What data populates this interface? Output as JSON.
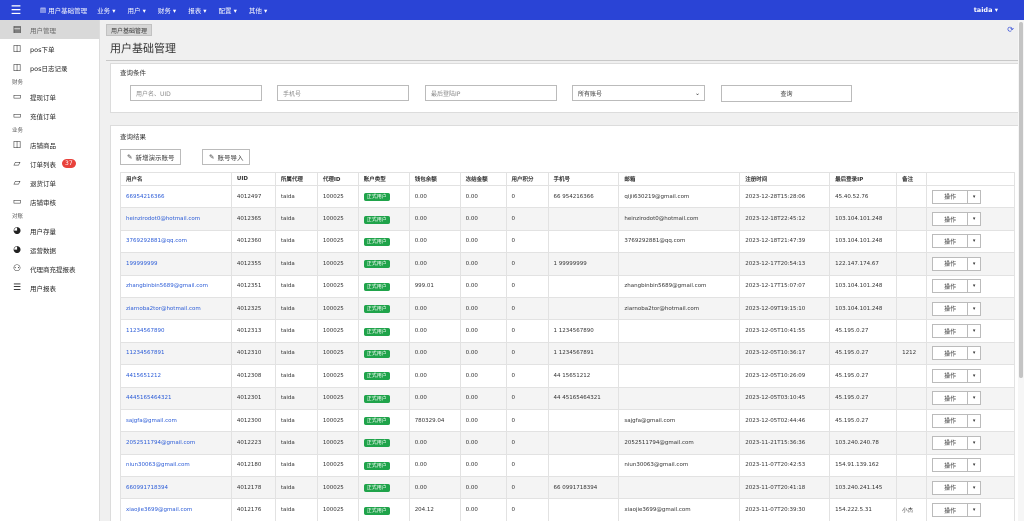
{
  "topbar": {
    "menu_icon": "hamburger-icon",
    "brand": "用户基础管理",
    "brand_icon": "document-icon",
    "menus": [
      "业务 ▾",
      "用户 ▾",
      "财务 ▾",
      "报表 ▾",
      "配置 ▾",
      "其他 ▾"
    ],
    "user": "taida ▾"
  },
  "sidebar": {
    "items": [
      {
        "label": "用户管理",
        "icon": "user-doc-icon",
        "glyph": "▤",
        "active": true
      },
      {
        "label": "pos下单",
        "icon": "columns-icon",
        "glyph": "◫"
      },
      {
        "label": "pos日志记录",
        "icon": "columns-icon",
        "glyph": "◫"
      },
      {
        "group": "财务"
      },
      {
        "label": "提现订单",
        "icon": "card-icon",
        "glyph": "▭"
      },
      {
        "label": "充值订单",
        "icon": "card-icon",
        "glyph": "▭"
      },
      {
        "group": "业务"
      },
      {
        "label": "店铺商品",
        "icon": "columns-icon",
        "glyph": "◫"
      },
      {
        "label": "订单列表",
        "icon": "order-icon",
        "glyph": "▱",
        "badge": "37"
      },
      {
        "label": "退货订单",
        "icon": "order-icon",
        "glyph": "▱"
      },
      {
        "label": "店铺审核",
        "icon": "card-icon",
        "glyph": "▭"
      },
      {
        "group": "对账"
      },
      {
        "label": "用户存量",
        "icon": "pie-chart-icon",
        "glyph": "◕"
      },
      {
        "label": "运营数据",
        "icon": "pie-chart-icon",
        "glyph": "◕"
      },
      {
        "label": "代理商充提报表",
        "icon": "sitemap-icon",
        "glyph": "⚇"
      },
      {
        "label": "用户报表",
        "icon": "list-icon",
        "glyph": "☰"
      }
    ]
  },
  "main": {
    "tab": "用户基础管理",
    "title": "用户基础管理",
    "refresh_icon": "refresh-icon"
  },
  "query": {
    "title": "查询条件",
    "user_placeholder": "用户名、UID",
    "phone_placeholder": "手机号",
    "ip_placeholder": "最后登陆IP",
    "account_select": "所有账号",
    "submit": "查询"
  },
  "results": {
    "title": "查询结果",
    "add_demo": "新增演示账号",
    "import": "账号导入",
    "columns": [
      "用户名",
      "UID",
      "所属代理",
      "代理ID",
      "账户类型",
      "钱包余额",
      "冻结金额",
      "用户积分",
      "手机号",
      "邮箱",
      "注册时间",
      "最后登录IP",
      "备注",
      ""
    ],
    "op_label": "操作",
    "rows": [
      [
        "66954216366",
        "4012497",
        "taida",
        "100025",
        "正式用户",
        "0.00",
        "0.00",
        "0",
        "66 954216366",
        "qijii630219@gmail.com",
        "2023-12-28T15:28:06",
        "45.40.52.76",
        ""
      ],
      [
        "heinzirodot0@hotmail.com",
        "4012365",
        "taida",
        "100025",
        "正式用户",
        "0.00",
        "0.00",
        "0",
        "",
        "heinzirodot0@hotmail.com",
        "2023-12-18T22:45:12",
        "103.104.101.248",
        ""
      ],
      [
        "3769292881@qq.com",
        "4012360",
        "taida",
        "100025",
        "正式用户",
        "0.00",
        "0.00",
        "0",
        "",
        "3769292881@qq.com",
        "2023-12-18T21:47:39",
        "103.104.101.248",
        ""
      ],
      [
        "199999999",
        "4012355",
        "taida",
        "100025",
        "正式用户",
        "0.00",
        "0.00",
        "0",
        "1 99999999",
        "",
        "2023-12-17T20:54:13",
        "122.147.174.67",
        ""
      ],
      [
        "zhangbinbin5689@gmail.com",
        "4012351",
        "taida",
        "100025",
        "正式用户",
        "999.01",
        "0.00",
        "0",
        "",
        "zhangbinbin5689@gmail.com",
        "2023-12-17T15:07:07",
        "103.104.101.248",
        ""
      ],
      [
        "ziarnoba2tor@hotmail.com",
        "4012325",
        "taida",
        "100025",
        "正式用户",
        "0.00",
        "0.00",
        "0",
        "",
        "ziarnoba2tor@hotmail.com",
        "2023-12-09T19:15:10",
        "103.104.101.248",
        ""
      ],
      [
        "11234567890",
        "4012313",
        "taida",
        "100025",
        "正式用户",
        "0.00",
        "0.00",
        "0",
        "1 1234567890",
        "",
        "2023-12-05T10:41:55",
        "45.195.0.27",
        ""
      ],
      [
        "11234567891",
        "4012310",
        "taida",
        "100025",
        "正式用户",
        "0.00",
        "0.00",
        "0",
        "1 1234567891",
        "",
        "2023-12-05T10:36:17",
        "45.195.0.27",
        "1212"
      ],
      [
        "4415651212",
        "4012308",
        "taida",
        "100025",
        "正式用户",
        "0.00",
        "0.00",
        "0",
        "44 15651212",
        "",
        "2023-12-05T10:26:09",
        "45.195.0.27",
        ""
      ],
      [
        "4445165464321",
        "4012301",
        "taida",
        "100025",
        "正式用户",
        "0.00",
        "0.00",
        "0",
        "44 45165464321",
        "",
        "2023-12-05T03:10:45",
        "45.195.0.27",
        ""
      ],
      [
        "sajgfa@gmail.com",
        "4012300",
        "taida",
        "100025",
        "正式用户",
        "780329.04",
        "0.00",
        "0",
        "",
        "sajgfa@gmail.com",
        "2023-12-05T02:44:46",
        "45.195.0.27",
        ""
      ],
      [
        "2052511794@gmail.com",
        "4012223",
        "taida",
        "100025",
        "正式用户",
        "0.00",
        "0.00",
        "0",
        "",
        "2052511794@gmail.com",
        "2023-11-21T15:36:36",
        "103.240.240.78",
        ""
      ],
      [
        "niun30063@gmail.com",
        "4012180",
        "taida",
        "100025",
        "正式用户",
        "0.00",
        "0.00",
        "0",
        "",
        "niun30063@gmail.com",
        "2023-11-07T20:42:53",
        "154.91.139.162",
        ""
      ],
      [
        "660991718394",
        "4012178",
        "taida",
        "100025",
        "正式用户",
        "0.00",
        "0.00",
        "0",
        "66 0991718394",
        "",
        "2023-11-07T20:41:18",
        "103.240.241.145",
        ""
      ],
      [
        "xiaojie3699@gmail.com",
        "4012176",
        "taida",
        "100025",
        "正式用户",
        "204.12",
        "0.00",
        "0",
        "",
        "xiaojie3699@gmail.com",
        "2023-11-07T20:39:30",
        "154.222.5.31",
        "小杰"
      ]
    ]
  }
}
